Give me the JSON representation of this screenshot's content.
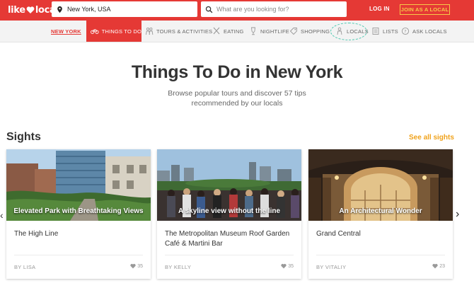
{
  "header": {
    "logo_left": "like",
    "logo_right": "local",
    "location_value": "New York, USA",
    "search_placeholder": "What are you looking for?",
    "login_label": "LOG IN",
    "join_label": "JOIN AS A LOCAL"
  },
  "nav": {
    "city": "NEW YORK",
    "items": [
      {
        "label": "THINGS TO DO",
        "icon": "bike-icon"
      },
      {
        "label": "TOURS & ACTIVITIES",
        "icon": "people-icon"
      },
      {
        "label": "EATING",
        "icon": "cutlery-icon"
      },
      {
        "label": "NIGHTLIFE",
        "icon": "glass-icon"
      },
      {
        "label": "SHOPPING",
        "icon": "tag-icon"
      },
      {
        "label": "LOCALS",
        "icon": "person-icon"
      },
      {
        "label": "LISTS",
        "icon": "list-icon"
      },
      {
        "label": "ASK LOCALS",
        "icon": "question-icon"
      }
    ]
  },
  "hero": {
    "title": "Things To Do in New York",
    "subtitle": "Browse popular tours and discover 57 tips recommended by our locals"
  },
  "section": {
    "title": "Sights",
    "see_all": "See all sights"
  },
  "cards": [
    {
      "tagline": "Elevated Park with Breathtaking Views",
      "name": "The High Line",
      "author": "BY LISA",
      "likes": "35"
    },
    {
      "tagline": "A skyline view without the line",
      "name": "The Metropolitan Museum Roof Garden Café & Martini Bar",
      "author": "BY KELLY",
      "likes": "35"
    },
    {
      "tagline": "An Architectural Wonder",
      "name": "Grand Central",
      "author": "BY VITALIY",
      "likes": "23"
    }
  ],
  "colors": {
    "brand_red": "#e53935",
    "accent_orange": "#f0a21b",
    "join_yellow": "#f7c948",
    "locals_teal": "#4cc9b0"
  }
}
